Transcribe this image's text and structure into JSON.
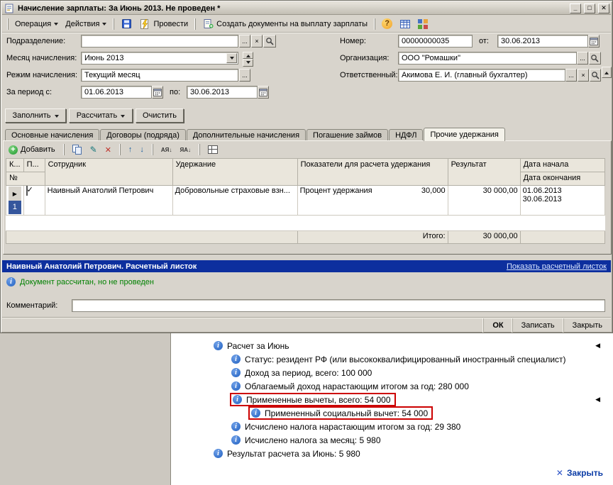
{
  "window": {
    "title": "Начисление зарплаты: За Июнь 2013. Не проведен *"
  },
  "icons": {
    "minimize": "_",
    "maximize": "□",
    "close": "✕",
    "ellipsis": "...",
    "clear": "×",
    "help": "?",
    "info": "i",
    "plus": "+",
    "edit": "✎",
    "delete": "✕",
    "move_up": "↑",
    "move_down": "↓",
    "sort_az": "АЯ↓",
    "sort_za": "ЯА↓",
    "row_marker": "▶",
    "expand_marker": "◀",
    "panel_close_x": "✕"
  },
  "toolbar": {
    "operation": "Операция",
    "actions": "Действия",
    "post": "Провести",
    "create_docs": "Создать документы на выплату зарплаты"
  },
  "form": {
    "department_label": "Подразделение:",
    "department_value": "",
    "number_label": "Номер:",
    "number_value": "00000000035",
    "number_from_label": "от:",
    "number_date": "30.06.2013",
    "month_label": "Месяц начисления:",
    "month_value": "Июнь 2013",
    "org_label": "Организация:",
    "org_value": "ООО \"Ромашки\"",
    "mode_label": "Режим начисления:",
    "mode_value": "Текущий месяц",
    "responsible_label": "Ответственный:",
    "responsible_value": "Акимова Е. И. (главный бухгалтер)",
    "period_label": "За период с:",
    "period_from": "01.06.2013",
    "period_to_label": "по:",
    "period_to": "30.06.2013"
  },
  "commands": {
    "fill": "Заполнить",
    "calculate": "Рассчитать",
    "clear": "Очистить"
  },
  "tabs": [
    {
      "label": "Основные начисления"
    },
    {
      "label": "Договоры (подряда)"
    },
    {
      "label": "Дополнительные начисления"
    },
    {
      "label": "Погашение займов"
    },
    {
      "label": "НДФЛ"
    },
    {
      "label": "Прочие удержания"
    }
  ],
  "grid": {
    "add_label": "Добавить",
    "header": {
      "col_k": "К...",
      "col_p": "П...",
      "num": "№",
      "employee": "Сотрудник",
      "deduction": "Удержание",
      "indicators": "Показатели для расчета удержания",
      "result": "Результат",
      "date_start": "Дата начала",
      "date_end": "Дата окончания"
    },
    "row": {
      "num": "1",
      "employee": "Наивный Анатолий Петрович",
      "deduction": "Добровольные страховые взн...",
      "indicator_name": "Процент удержания",
      "indicator_value": "30,000",
      "result": "30 000,00",
      "date_start": "01.06.2013",
      "date_end": "30.06.2013"
    },
    "total_label": "Итого:",
    "total_value": "30 000,00"
  },
  "footer": {
    "selection_title": "Наивный Анатолий Петрович. Расчетный листок",
    "selection_link": "Показать расчетный листок",
    "status": "Документ рассчитан, но не проведен",
    "comment_label": "Комментарий:",
    "ok": "ОК",
    "save": "Записать",
    "close": "Закрыть"
  },
  "payslip": {
    "lines": [
      {
        "text": "Расчет за Июнь"
      },
      {
        "text": "Статус: резидент РФ (или высококвалифицированный иностранный специалист)"
      },
      {
        "text": "Доход за период, всего: 100 000"
      },
      {
        "text": "Облагаемый доход нарастающим итогом за год: 280 000"
      },
      {
        "text": "Примененные вычеты, всего: 54 000"
      },
      {
        "text": "Примененный социальный вычет: 54 000"
      },
      {
        "text": "Исчислено налога нарастающим итогом за год: 29 380"
      },
      {
        "text": "Исчислено налога за месяц: 5 980"
      },
      {
        "text": "Результат расчета за Июнь: 5 980"
      }
    ],
    "close_label": "Закрыть"
  },
  "colors": {
    "selection_blue": "#0d2f9e",
    "status_green": "#008000",
    "annotation_red": "#cc0000"
  }
}
